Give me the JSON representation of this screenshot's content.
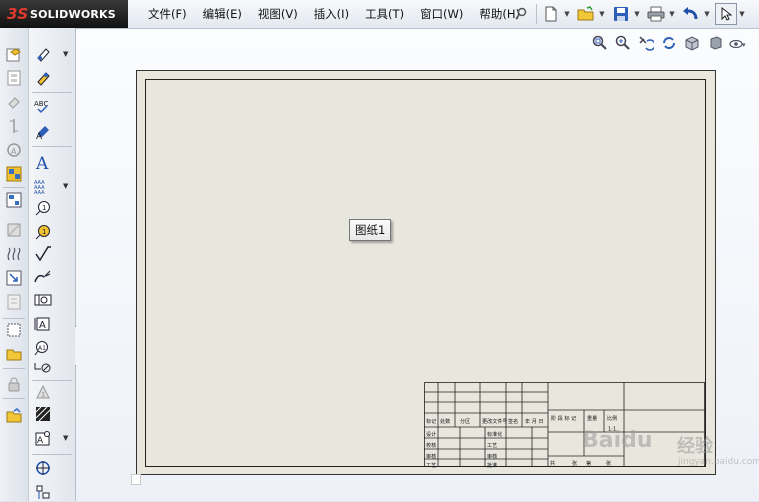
{
  "app": {
    "brand_mark": "3S",
    "brand_name": "SOLIDWORKS"
  },
  "menu": [
    "文件(F)",
    "编辑(E)",
    "视图(V)",
    "插入(I)",
    "工具(T)",
    "窗口(W)",
    "帮助(H)"
  ],
  "sheet": {
    "tooltip": "图纸1"
  },
  "title_block": {
    "row_labels": [
      "标记",
      "处数",
      "分区",
      "更改文件号",
      "签名",
      "年 月 日"
    ],
    "left_labels": [
      "设计",
      "校核",
      "审核",
      "工艺"
    ],
    "mid_labels": [
      "标准化",
      "工艺",
      "审核",
      "批准"
    ],
    "stage_labels": [
      "阶 段 标 记",
      "重量",
      "比例"
    ],
    "scale": "1:1",
    "bottom_labels": [
      "共",
      "张",
      "第",
      "张"
    ]
  },
  "watermark": {
    "text": "Baidu",
    "cn": "经验",
    "sub": "jingyan.baidu.com"
  },
  "colors": {
    "sheet": "#e8e7de",
    "accent": "#e03a2f"
  }
}
